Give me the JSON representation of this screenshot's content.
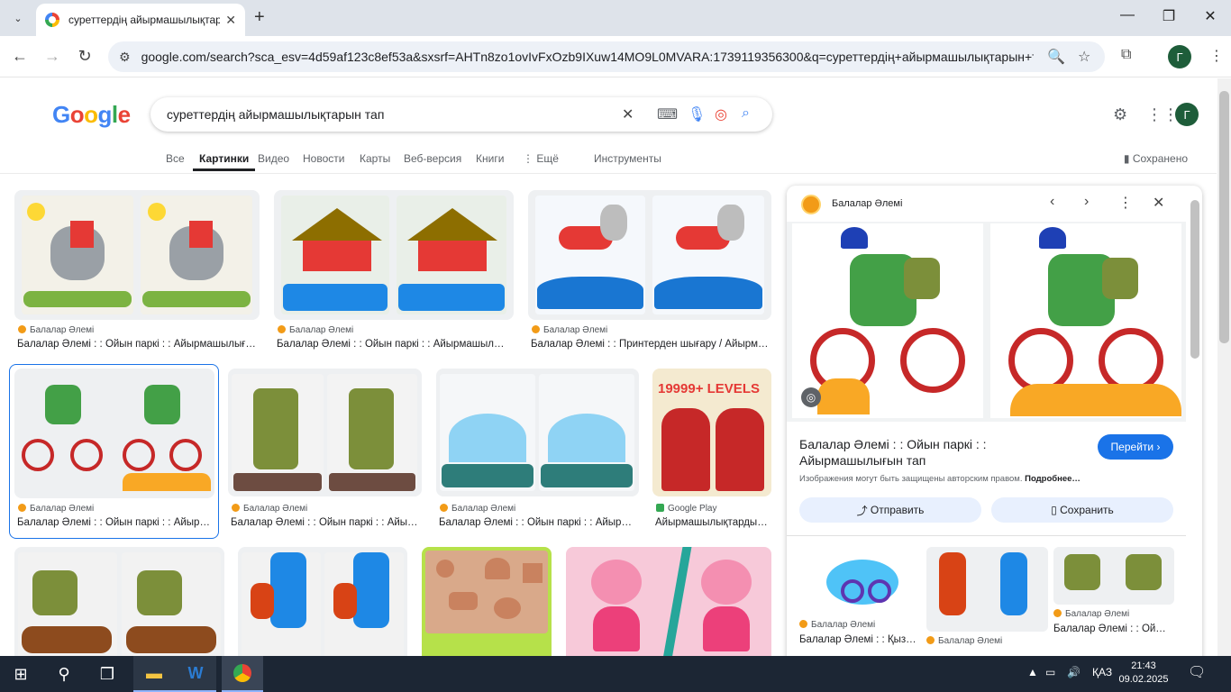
{
  "browser": {
    "tab_title": "суреттердің айырмашылықтар",
    "url": "google.com/search?sca_esv=4d59af123c8ef53a&sxsrf=AHTn8zo1ovIvFxOzb9IXuw14MO9L0MVARA:1739119356300&q=суреттердің+айырмашылықтарын+т...",
    "avatar": "Г"
  },
  "search": {
    "logo": [
      "G",
      "o",
      "o",
      "g",
      "l",
      "e"
    ],
    "query": "суреттердің айырмашылықтарын тап"
  },
  "tabs": [
    "Все",
    "Картинки",
    "Видео",
    "Новости",
    "Карты",
    "Веб-версия",
    "Книги",
    "⋮ Ещё",
    "Инструменты"
  ],
  "saved": "Сохранено",
  "results": [
    {
      "source": "Балалар Әлемі",
      "caption": "Балалар Әлемі : : Ойын паркі : : Айырмашылығ…"
    },
    {
      "source": "Балалар Әлемі",
      "caption": "Балалар Әлемі : : Ойын паркі : : Айырмашыл…"
    },
    {
      "source": "Балалар Әлемі",
      "caption": "Балалар Әлемі : : Принтерден шығару / Айырм…"
    },
    {
      "source": "Балалар Әлемі",
      "caption": "Балалар Әлемі : : Ойын паркі : : Айыр…"
    },
    {
      "source": "Балалар Әлемі",
      "caption": "Балалар Әлемі : : Ойын паркі : : Айы…"
    },
    {
      "source": "Балалар Әлемі",
      "caption": "Балалар Әлемі : : Ойын паркі : : Айыр…"
    },
    {
      "source": "Google Play",
      "caption": "Айырмашылықтарды…"
    }
  ],
  "thumb_text": "19999+ LEVELS",
  "panel": {
    "site": "Балалар Әлемі",
    "title": "Балалар Әлемі : : Ойын паркі : : Айырмашылығын тап",
    "visit": "Перейти",
    "copyright": "Изображения могут быть защищены авторским правом.",
    "more": "Подробнее…",
    "share": "Отправить",
    "save": "Сохранить",
    "related": [
      {
        "source": "Балалар Әлемі",
        "caption": "Балалар Әлемі : : Қыз…"
      },
      {
        "source": "Балалар Әлемі",
        "caption": ""
      },
      {
        "source": "Балалар Әлемі",
        "caption": "Балалар Әлемі : : Ой…"
      }
    ]
  },
  "taskbar": {
    "lang": "ҚАЗ",
    "time": "21:43",
    "date": "09.02.2025"
  }
}
